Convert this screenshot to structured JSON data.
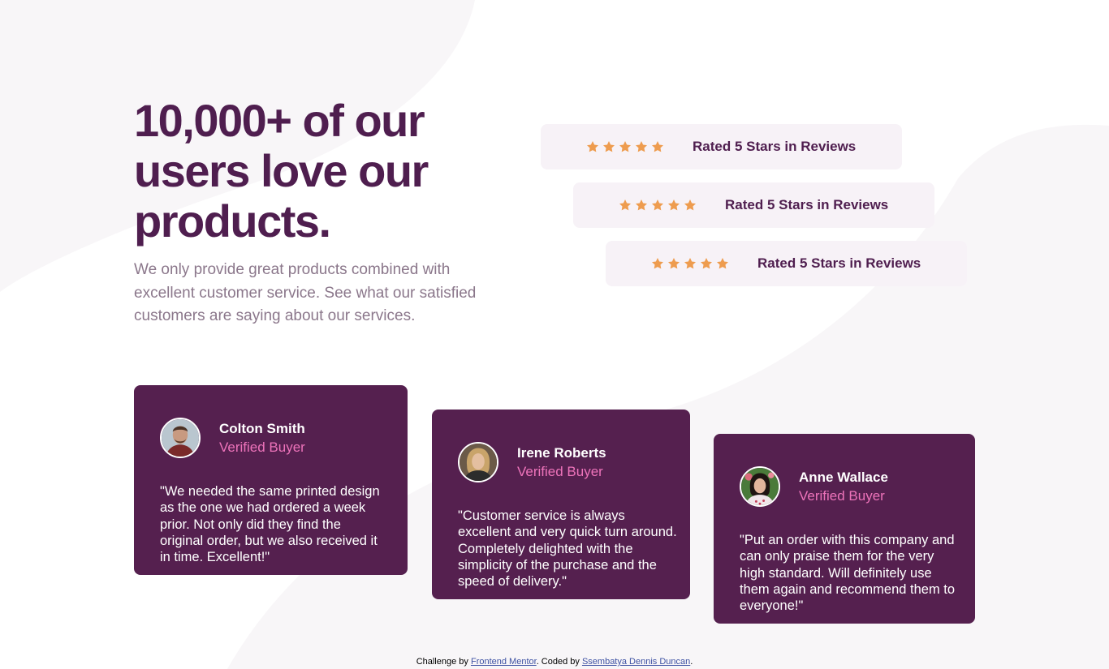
{
  "hero": {
    "title": "10,000+ of our users love our products.",
    "description": "We only provide great products combined with excellent customer service. See what our satisfied customers are saying about our services."
  },
  "ratings": [
    {
      "label": "Rated 5 Stars in Reviews",
      "stars": 5
    },
    {
      "label": "Rated 5 Stars in Reviews",
      "stars": 5
    },
    {
      "label": "Rated 5 Stars in Reviews",
      "stars": 5
    }
  ],
  "testimonials": [
    {
      "name": "Colton Smith",
      "status": "Verified Buyer",
      "quote": "\"We needed the same printed design as the one we had ordered a week prior. Not only did they find the original order, but we also received it in time. Excellent!\""
    },
    {
      "name": "Irene Roberts",
      "status": "Verified Buyer",
      "quote": "\"Customer service is always excellent and very quick turn around. Completely delighted with the simplicity of the purchase and the speed of delivery.\""
    },
    {
      "name": "Anne Wallace",
      "status": "Verified Buyer",
      "quote": "\"Put an order with this company and can only praise them for the very high standard. Will definitely use them again and recommend them to everyone!\""
    }
  ],
  "footer": {
    "prefix": "Challenge by",
    "challenge_link": "Frontend Mentor",
    "middle": ". Coded by",
    "author_link": "Ssembatya Dennis Duncan",
    "suffix": "."
  },
  "colors": {
    "heading": "#4f1e4f",
    "card_bg": "#55204f",
    "accent_pink": "#ed73ba",
    "star": "#ee9c4f",
    "rating_bg": "#f7f2f7",
    "muted_text": "#8b778b"
  },
  "icons": {
    "star": "star-icon",
    "avatar": "avatar"
  }
}
